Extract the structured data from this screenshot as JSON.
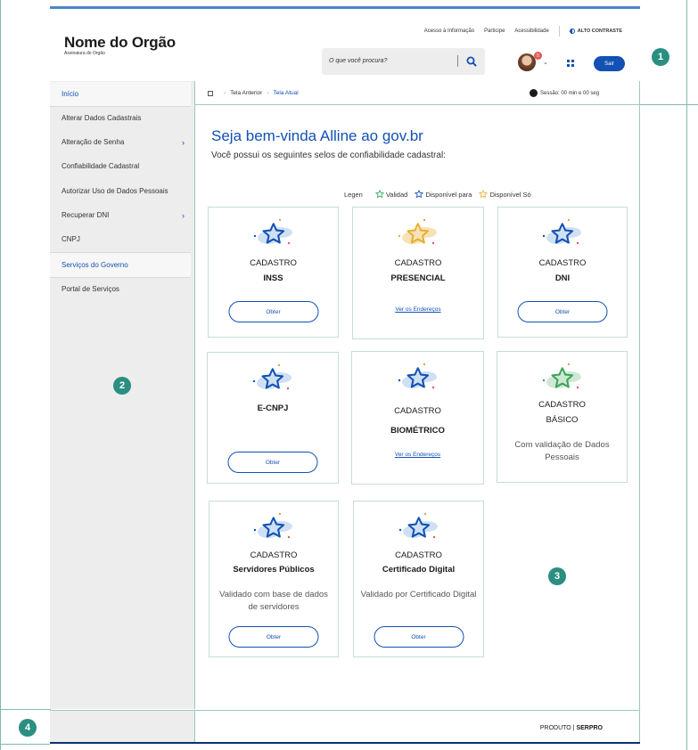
{
  "header": {
    "org_name": "Nome do Orgão",
    "org_subtitle": "Assinatura do Orgão",
    "links": [
      "Acesso à Informação",
      "Participe",
      "Acessibilidade"
    ],
    "contrast_label": "ALTO CONTRASTE",
    "search_placeholder": "O que você procura?",
    "notification_count": "5",
    "logout_label": "Sair"
  },
  "sidebar": {
    "items": [
      {
        "label": "Início",
        "selected": true,
        "arrow": false
      },
      {
        "label": "Alterar Dados Cadastrais",
        "selected": false,
        "arrow": false
      },
      {
        "label": "Alteração de Senha",
        "selected": false,
        "arrow": true
      },
      {
        "label": "Confiabilidade Cadastral",
        "selected": false,
        "arrow": false
      },
      {
        "label": "Autorizar Uso de Dados Pessoais",
        "selected": false,
        "arrow": false
      },
      {
        "label": "Recuperar DNI",
        "selected": false,
        "arrow": true
      },
      {
        "label": "CNPJ",
        "selected": false,
        "arrow": false
      },
      {
        "label": "Serviços do Governo",
        "selected": true,
        "arrow": false
      },
      {
        "label": "Portal de Serviços",
        "selected": false,
        "arrow": false
      }
    ]
  },
  "breadcrumb": {
    "previous": "Tela Anterior",
    "current": "Tela Atual"
  },
  "session": {
    "text": "Sessão: 00 min e 00 seg"
  },
  "main": {
    "welcome": "Seja bem-vinda Alline ao gov.br",
    "subtitle": "Você possui os seguintes selos de confiabilidade cadastral:",
    "legend": {
      "label": "Legen",
      "items": [
        {
          "label": "Validad",
          "color": "#3aa55a"
        },
        {
          "label": "Disponível para",
          "color": "#1351b4"
        },
        {
          "label": "Disponível Só",
          "color": "#e8b030"
        }
      ]
    },
    "cards": [
      {
        "line1": "CADASTRO",
        "line2": "INSS",
        "star_color": "#1351b4",
        "blob_color": "#cfe0f5",
        "action": "button",
        "action_label": "Obter",
        "desc": ""
      },
      {
        "line1": "CADASTRO",
        "line2": "PRESENCIAL",
        "star_color": "#e8b030",
        "blob_color": "#f7e2b8",
        "action": "link",
        "action_label": "Ver os Endereços",
        "desc": ""
      },
      {
        "line1": "CADASTRO",
        "line2": "DNI",
        "star_color": "#1351b4",
        "blob_color": "#cfe0f5",
        "action": "button",
        "action_label": "Obter",
        "desc": ""
      },
      {
        "line1": "E-CNPJ",
        "line2": "",
        "star_color": "#1351b4",
        "blob_color": "#cfe0f5",
        "action": "button",
        "action_label": "Obter",
        "desc": ""
      },
      {
        "line1": "CADASTRO",
        "line2": "BIOMÉTRICO",
        "star_color": "#1351b4",
        "blob_color": "#cfe0f5",
        "action": "link",
        "action_label": "Ver os Endereços",
        "desc": ""
      },
      {
        "line1": "CADASTRO",
        "line2": "BÁSICO",
        "star_color": "#3aa55a",
        "blob_color": "#cfe8d4",
        "action": "none",
        "action_label": "",
        "desc": "Com validação de Dados Pessoais"
      },
      {
        "line1": "CADASTRO",
        "line2": "Servidores Públicos",
        "star_color": "#1351b4",
        "blob_color": "#cfe0f5",
        "action": "button",
        "action_label": "Obter",
        "desc": "Validado com base de dados de servidores"
      },
      {
        "line1": "CADASTRO",
        "line2": "Certificado Digital",
        "star_color": "#1351b4",
        "blob_color": "#cfe0f5",
        "action": "button",
        "action_label": "Obter",
        "desc": "Validado por Certificado Digital"
      }
    ]
  },
  "footer": {
    "brand_prefix": "PRODUTO |",
    "brand_name": "SERPRO"
  },
  "markers": [
    "1",
    "2",
    "3",
    "4"
  ]
}
